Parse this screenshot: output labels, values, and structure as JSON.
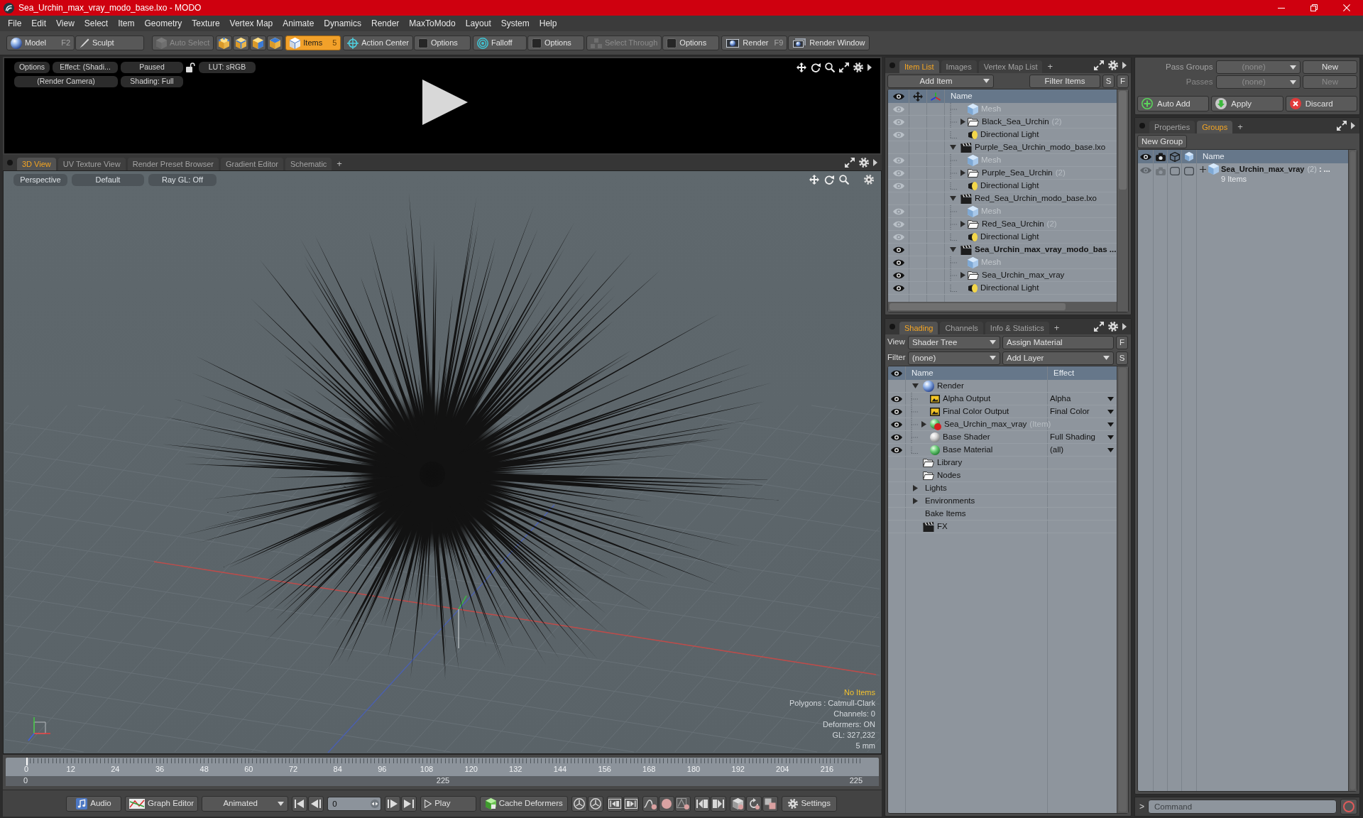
{
  "window": {
    "title": "Sea_Urchin_max_vray_modo_base.lxo - MODO"
  },
  "menu": [
    "File",
    "Edit",
    "View",
    "Select",
    "Item",
    "Geometry",
    "Texture",
    "Vertex Map",
    "Animate",
    "Dynamics",
    "Render",
    "MaxToModo",
    "Layout",
    "System",
    "Help"
  ],
  "toolbar": [
    {
      "buttons": [
        {
          "kind": "model",
          "label": "Model",
          "shortcut": "F2",
          "selected": false,
          "disabled": false
        },
        {
          "kind": "sculpt",
          "label": "Sculpt",
          "selected": false,
          "disabled": false
        }
      ]
    },
    {
      "buttons": [
        {
          "kind": "auto-select",
          "label": "Auto Select",
          "selected": false,
          "disabled": true
        }
      ]
    },
    {
      "buttons": [
        {
          "kind": "vertices",
          "selected": false,
          "disabled": false
        },
        {
          "kind": "edges",
          "selected": false,
          "disabled": false
        },
        {
          "kind": "polygons",
          "selected": false,
          "disabled": false
        },
        {
          "kind": "materials",
          "selected": false,
          "disabled": false
        }
      ]
    },
    {
      "buttons": [
        {
          "kind": "items",
          "label": "Items",
          "shortcut": "5",
          "selected": true,
          "disabled": false
        }
      ]
    },
    {
      "buttons": [
        {
          "kind": "action-center",
          "label": "Action Center",
          "selected": false,
          "disabled": false
        },
        {
          "kind": "options",
          "label": "Options",
          "selected": false,
          "disabled": false
        }
      ]
    },
    {
      "buttons": [
        {
          "kind": "falloff",
          "label": "Falloff",
          "selected": false,
          "disabled": false
        },
        {
          "kind": "options",
          "label": "Options",
          "selected": false,
          "disabled": false
        }
      ]
    },
    {
      "buttons": [
        {
          "kind": "select-through",
          "label": "Select Through",
          "selected": false,
          "disabled": true
        },
        {
          "kind": "options",
          "label": "Options",
          "selected": false,
          "disabled": false
        }
      ]
    },
    {
      "buttons": [
        {
          "kind": "render",
          "label": "Render",
          "shortcut": "F9",
          "selected": false,
          "disabled": false
        },
        {
          "kind": "render-window",
          "label": "Render Window",
          "selected": false,
          "disabled": false
        }
      ]
    }
  ],
  "render_preview": {
    "options": "Options",
    "effect": "Effect: (Shadi...",
    "state": "Paused",
    "locked": false,
    "lut": "LUT: sRGB",
    "camera": "(Render Camera)",
    "shading": "Shading: Full"
  },
  "viewport_tabs": {
    "tabs": [
      {
        "label": "3D View",
        "selected": true
      },
      {
        "label": "UV Texture View",
        "selected": false
      },
      {
        "label": "Render Preset Browser",
        "selected": false
      },
      {
        "label": "Gradient Editor",
        "selected": false
      },
      {
        "label": "Schematic",
        "selected": false
      }
    ],
    "add_tab": "+"
  },
  "viewport": {
    "options": [
      "Perspective",
      "Default",
      "Ray GL: Off"
    ],
    "info": [
      {
        "kind": "alert",
        "text": "No Items"
      },
      {
        "kind": "stat",
        "text": "Polygons : Catmull-Clark"
      },
      {
        "kind": "stat",
        "text": "Channels: 0"
      },
      {
        "kind": "stat",
        "text": "Deformers: ON"
      },
      {
        "kind": "stat",
        "text": "GL: 327,232"
      },
      {
        "kind": "stat",
        "text": "5 mm"
      }
    ]
  },
  "timeline": {
    "ticks": [
      "0",
      "12",
      "24",
      "36",
      "48",
      "60",
      "72",
      "84",
      "96",
      "108",
      "120",
      "132",
      "144",
      "156",
      "168",
      "180",
      "192",
      "204",
      "216"
    ],
    "range_start": "0",
    "range_middle": "225",
    "range_end": "225"
  },
  "bottom_bar": {
    "groups": [
      [
        {
          "kind": "audio",
          "label": "Audio"
        }
      ],
      [
        {
          "kind": "graph-editor",
          "label": "Graph Editor"
        }
      ],
      [
        {
          "kind": "mode-menu",
          "label": "Animated"
        }
      ],
      [
        {
          "kind": "first-frame"
        },
        {
          "kind": "previous-frame"
        }
      ],
      [
        {
          "kind": "frame-field",
          "value": "0"
        }
      ],
      [
        {
          "kind": "next-frame"
        },
        {
          "kind": "last-frame"
        }
      ],
      [
        {
          "kind": "play",
          "label": "Play"
        }
      ],
      [
        {
          "kind": "cache-deformers",
          "label": "Cache Deformers"
        }
      ],
      [
        {
          "kind": "dial"
        },
        {
          "kind": "dial"
        }
      ],
      [
        {
          "kind": "key-back"
        },
        {
          "kind": "key-forward"
        }
      ],
      [
        {
          "kind": "curve"
        },
        {
          "kind": "dot"
        },
        {
          "kind": "key"
        }
      ],
      [
        {
          "kind": "jump-back"
        },
        {
          "kind": "jump-forward"
        }
      ],
      [
        {
          "kind": "cube-gear"
        },
        {
          "kind": "refresh"
        },
        {
          "kind": "stack"
        }
      ],
      [
        {
          "kind": "settings",
          "label": "Settings"
        }
      ]
    ]
  },
  "item_list": {
    "tabs": [
      {
        "label": "Item List",
        "selected": true
      },
      {
        "label": "Images",
        "selected": false
      },
      {
        "label": "Vertex Map List",
        "selected": false
      }
    ],
    "add_tab": "+",
    "add_item": "Add Item",
    "filter": {
      "placeholder": "Filter Items"
    },
    "buttons": [
      "S",
      "F"
    ],
    "column": "Name",
    "items": [
      {
        "children": [
          {
            "kind": "mesh",
            "label": "Mesh",
            "eye_greyed": true,
            "disabled": true
          },
          {
            "kind": "group",
            "label": "Black_Sea_Urchin",
            "count": "(2)",
            "eye_greyed": true,
            "expanded": false,
            "disabled": false
          },
          {
            "kind": "light",
            "label": "Directional Light",
            "eye_greyed": true,
            "disabled": false
          }
        ]
      },
      {
        "kind": "scene",
        "label": "Purple_Sea_Urchin_modo_base.lxo",
        "expanded": true,
        "current": false,
        "children": [
          {
            "kind": "mesh",
            "label": "Mesh",
            "eye_greyed": true,
            "disabled": true
          },
          {
            "kind": "group",
            "label": "Purple_Sea_Urchin",
            "count": "(2)",
            "eye_greyed": true,
            "expanded": false,
            "disabled": false
          },
          {
            "kind": "light",
            "label": "Directional Light",
            "eye_greyed": true,
            "disabled": false
          }
        ]
      },
      {
        "kind": "scene",
        "label": "Red_Sea_Urchin_modo_base.lxo",
        "expanded": true,
        "current": false,
        "children": [
          {
            "kind": "mesh",
            "label": "Mesh",
            "eye_greyed": true,
            "disabled": true
          },
          {
            "kind": "group",
            "label": "Red_Sea_Urchin",
            "count": "(2)",
            "eye_greyed": true,
            "expanded": false,
            "disabled": false
          },
          {
            "kind": "light",
            "label": "Directional Light",
            "eye_greyed": true,
            "disabled": false
          }
        ]
      },
      {
        "kind": "scene",
        "label": "Sea_Urchin_max_vray_modo_bas ...",
        "expanded": true,
        "current": true,
        "eye_greyed": false,
        "children": [
          {
            "kind": "mesh",
            "label": "Mesh",
            "eye_greyed": false,
            "disabled": true
          },
          {
            "kind": "group",
            "label": "Sea_Urchin_max_vray",
            "eye_greyed": false,
            "expanded": false,
            "disabled": false
          },
          {
            "kind": "light",
            "label": "Directional Light",
            "eye_greyed": false,
            "disabled": false
          }
        ]
      }
    ]
  },
  "shading": {
    "tabs": [
      {
        "label": "Shading",
        "selected": true
      },
      {
        "label": "Channels",
        "selected": false
      },
      {
        "label": "Info & Statistics",
        "selected": false
      }
    ],
    "add_tab": "+",
    "view_label": "View",
    "view": "Shader Tree",
    "assign": "Assign Material",
    "assign_button": "F",
    "filter_label": "Filter",
    "filter": "(none)",
    "add_layer": "Add Layer",
    "filter_button": "S",
    "columns": [
      "Name",
      "Effect"
    ],
    "items": [
      {
        "kind": "render",
        "label": "Render",
        "expanded": true,
        "children": [
          {
            "kind": "output",
            "label": "Alpha Output",
            "effect": "Alpha",
            "visible": true
          },
          {
            "kind": "output",
            "label": "Final Color Output",
            "effect": "Final Color",
            "visible": true
          },
          {
            "kind": "material-group",
            "label": "Sea_Urchin_max_vray",
            "tag": "(Item)",
            "expanded": false,
            "visible": true
          },
          {
            "kind": "shader",
            "label": "Base Shader",
            "effect": "Full Shading",
            "visible": true
          },
          {
            "kind": "material",
            "label": "Base Material",
            "effect": "(all)",
            "visible": true
          }
        ]
      },
      {
        "kind": "folder",
        "label": "Library"
      },
      {
        "kind": "folder",
        "label": "Nodes"
      },
      {
        "kind": "group",
        "label": "Lights",
        "expanded": false
      },
      {
        "kind": "group",
        "label": "Environments",
        "expanded": false
      },
      {
        "kind": "plain",
        "label": "Bake Items"
      },
      {
        "kind": "fx",
        "label": "FX"
      }
    ]
  },
  "passes": {
    "rows": [
      {
        "label": "Pass Groups",
        "value": "(none)",
        "button": "New",
        "disabled": false
      },
      {
        "label": "Passes",
        "value": "(none)",
        "button": "New",
        "disabled": true
      }
    ],
    "actions": [
      {
        "kind": "auto-add",
        "label": "Auto Add"
      },
      {
        "kind": "apply",
        "label": "Apply"
      },
      {
        "kind": "discard",
        "label": "Discard"
      }
    ]
  },
  "groups": {
    "tabs": [
      {
        "label": "Properties",
        "selected": false
      },
      {
        "label": "Groups",
        "selected": true
      }
    ],
    "add_tab": "+",
    "new_group": "New Group",
    "column": "Name",
    "items": [
      {
        "label": "Sea_Urchin_max_vray",
        "count": "(2)",
        "suffix": ": ...",
        "detail": "9 Items",
        "expanded": false
      }
    ]
  },
  "command": {
    "prompt": ">",
    "placeholder": "Command"
  }
}
